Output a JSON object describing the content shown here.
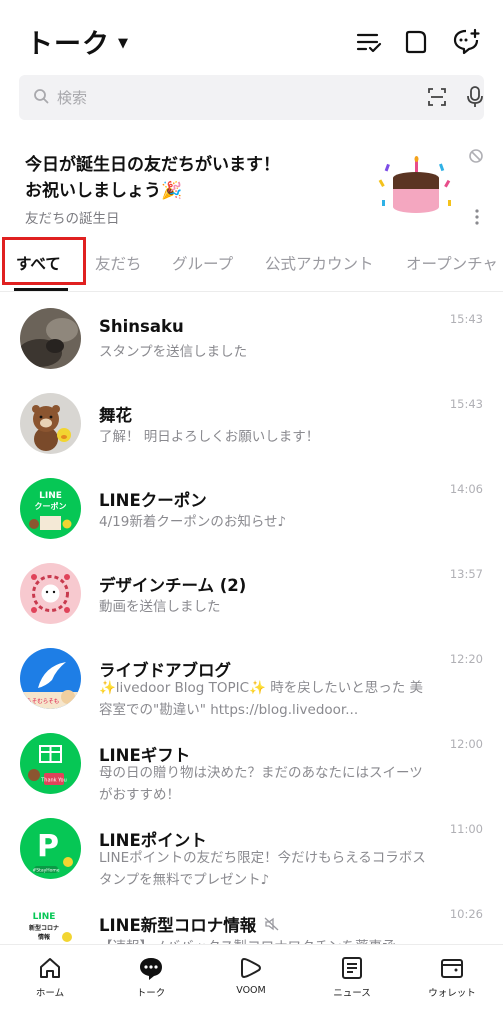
{
  "header": {
    "title": "トーク",
    "icons": [
      "edit-list-icon",
      "square-icon",
      "new-chat-icon"
    ]
  },
  "search": {
    "placeholder": "検索"
  },
  "banner": {
    "line1": "今日が誕生日の友だちがいます！",
    "line2": "お祝いしましょう🎉",
    "subtitle": "友だちの誕生日"
  },
  "tabs": [
    {
      "label": "すべて",
      "active": true
    },
    {
      "label": "友だち",
      "active": false
    },
    {
      "label": "グループ",
      "active": false
    },
    {
      "label": "公式アカウント",
      "active": false
    },
    {
      "label": "オープンチャ",
      "active": false
    }
  ],
  "chats": [
    {
      "name": "Shinsaku",
      "message": "スタンプを送信しました",
      "time": "15:43"
    },
    {
      "name": "舞花",
      "message": "了解！ 明日よろしくお願いします！",
      "time": "15:43"
    },
    {
      "name": "LINEクーポン",
      "message": "4/19新着クーポンのお知らせ♪",
      "time": "14:06",
      "avatar_text": "LINE クーポン",
      "avatar_sub": "Keep Distance"
    },
    {
      "name": "デザインチーム (2)",
      "message": "動画を送信しました",
      "time": "13:57"
    },
    {
      "name": "ライブドアブログ",
      "message": "✨livedoor Blog TOPIC✨ 時を戻したいと思った 美容室での\"勘違い\" https://blog.livedoor...",
      "time": "12:20",
      "avatar_text": "ひらそむらそも"
    },
    {
      "name": "LINEギフト",
      "message": "母の日の贈り物は決めた？まだのあなたにはスイーツがおすすめ！",
      "time": "12:00",
      "avatar_text": "Thank You"
    },
    {
      "name": "LINEポイント",
      "message": "LINEポイントの友だち限定！今だけもらえるコラボスタンプを無料でプレゼント♪",
      "time": "11:00",
      "avatar_text": "#StayHome"
    },
    {
      "name": "LINE新型コロナ情報",
      "message": "【速報】ノババックス製コロナワクチンを薬事承",
      "time": "10:26",
      "avatar_text": "LINE 新型コロナ 情報"
    }
  ],
  "bottom_nav": [
    {
      "label": "ホーム",
      "icon": "home-icon"
    },
    {
      "label": "トーク",
      "icon": "talk-icon"
    },
    {
      "label": "VOOM",
      "icon": "voom-icon"
    },
    {
      "label": "ニュース",
      "icon": "news-icon"
    },
    {
      "label": "ウォレット",
      "icon": "wallet-icon"
    }
  ],
  "colors": {
    "line_green": "#06c755",
    "highlight_red": "#e02020",
    "livedoor_blue": "#1e7ee6"
  }
}
